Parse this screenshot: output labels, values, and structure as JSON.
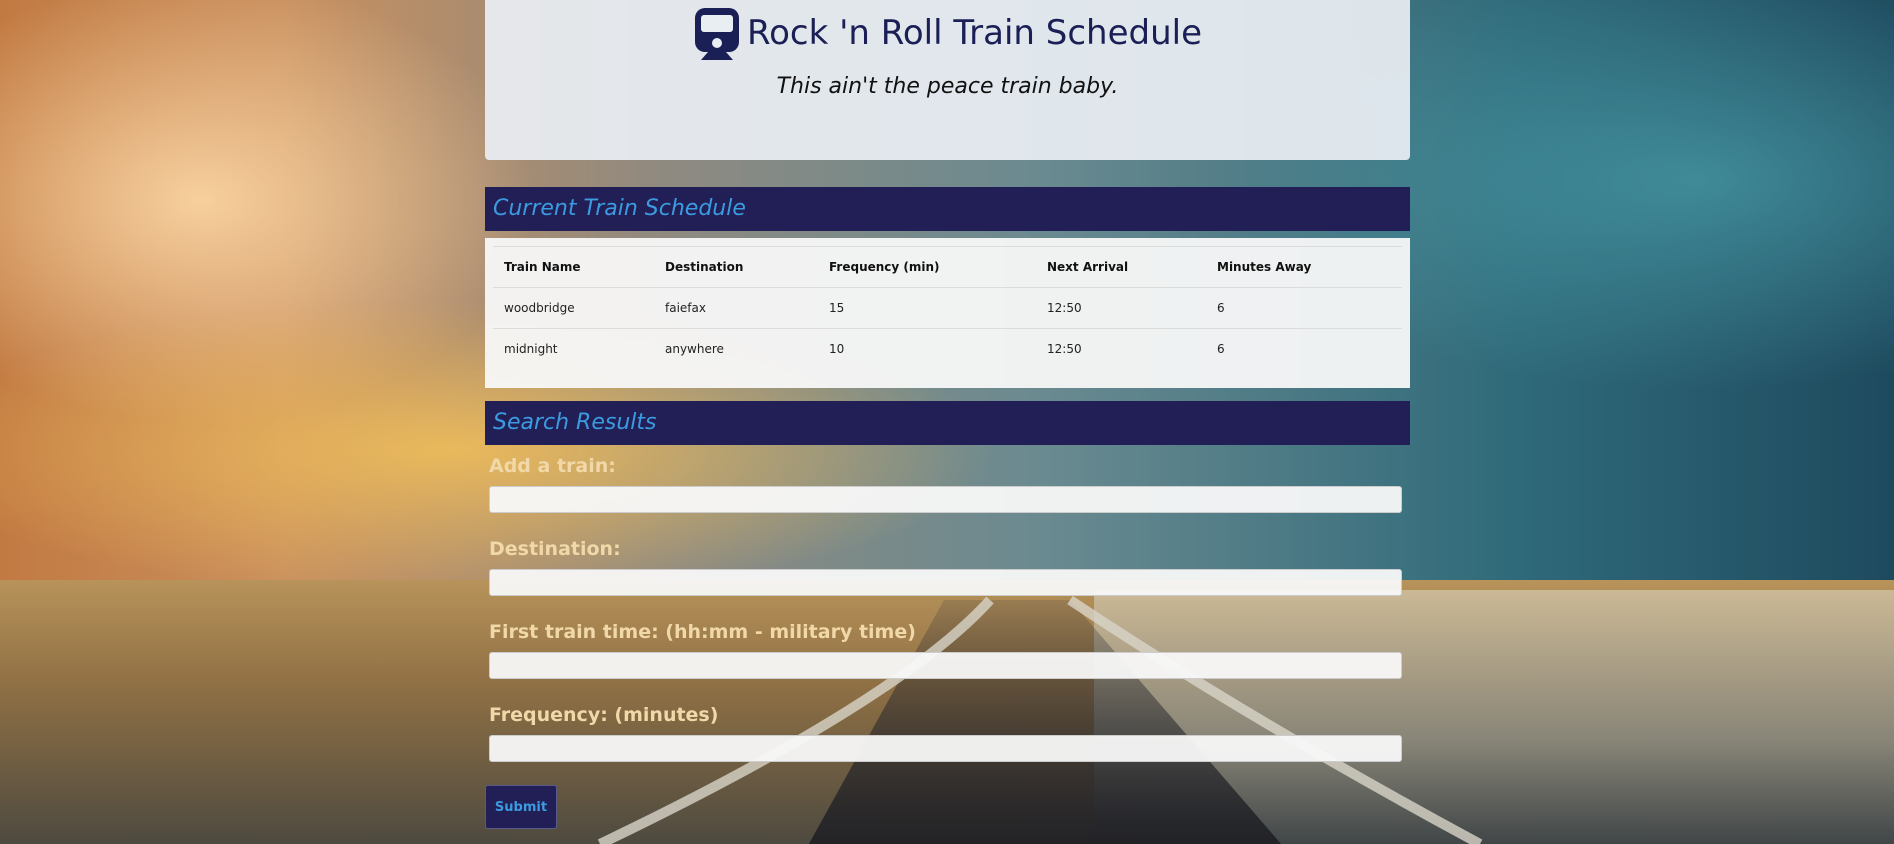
{
  "header": {
    "title": "Rock 'n Roll Train Schedule",
    "subtitle": "This ain't the peace train baby.",
    "icon": "train-icon"
  },
  "schedule": {
    "heading": "Current Train Schedule",
    "columns": [
      "Train Name",
      "Destination",
      "Frequency (min)",
      "Next Arrival",
      "Minutes Away"
    ],
    "rows": [
      [
        "woodbridge",
        "faiefax",
        "15",
        "12:50",
        "6"
      ],
      [
        "midnight",
        "anywhere",
        "10",
        "12:50",
        "6"
      ]
    ]
  },
  "form": {
    "heading": "Search Results",
    "fields": [
      {
        "label": "Add a train:",
        "value": ""
      },
      {
        "label": "Destination:",
        "value": ""
      },
      {
        "label": "First train time: (hh:mm - military time)",
        "value": ""
      },
      {
        "label": "Frequency: (minutes)",
        "value": ""
      }
    ],
    "submit_label": "Submit"
  },
  "colors": {
    "header_bar": "#221f56",
    "heading_text": "#3b9be0",
    "title_text": "#1a1f55",
    "label_text": "#f1d8a8"
  }
}
